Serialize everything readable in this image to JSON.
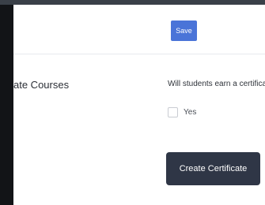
{
  "header": {
    "save_label": "Save"
  },
  "section": {
    "title": "ate Courses"
  },
  "certificate": {
    "question": "Will students earn a certifica",
    "option_yes_label": "Yes",
    "create_label": "Create Certificate"
  }
}
